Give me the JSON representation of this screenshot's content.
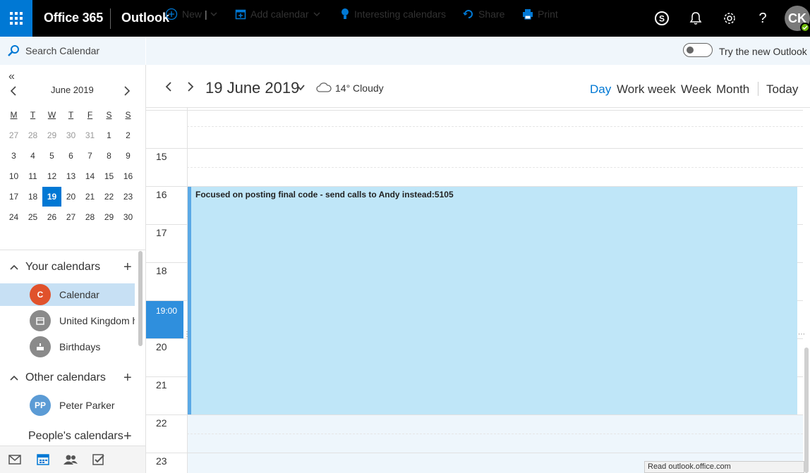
{
  "topbar": {
    "suite_name": "Office 365",
    "app_name": "Outlook",
    "avatar_initials": "CK",
    "accent_color": "#0078d4"
  },
  "search": {
    "label": "Search Calendar"
  },
  "commands": {
    "new_label": "New",
    "add_calendar_label": "Add calendar",
    "interesting_label": "Interesting calendars",
    "share_label": "Share",
    "print_label": "Print",
    "try_new_label": "Try the new Outlook"
  },
  "mini_calendar": {
    "collapse_glyph": "«",
    "month_title": "June 2019",
    "weekdays": [
      "M",
      "T",
      "W",
      "T",
      "F",
      "S",
      "S"
    ],
    "weeks": [
      [
        "27",
        "28",
        "29",
        "30",
        "31",
        "1",
        "2"
      ],
      [
        "3",
        "4",
        "5",
        "6",
        "7",
        "8",
        "9"
      ],
      [
        "10",
        "11",
        "12",
        "13",
        "14",
        "15",
        "16"
      ],
      [
        "17",
        "18",
        "19",
        "20",
        "21",
        "22",
        "23"
      ],
      [
        "24",
        "25",
        "26",
        "27",
        "28",
        "29",
        "30"
      ]
    ],
    "selected_day": "19"
  },
  "your_calendars": {
    "heading": "Your calendars",
    "items": [
      {
        "initial": "C",
        "name": "Calendar",
        "color": "#e0522c"
      },
      {
        "initial": "",
        "name": "United Kingdom holidays",
        "color": "#8a8a8a"
      },
      {
        "initial": "",
        "name": "Birthdays",
        "color": "#8a8a8a"
      }
    ]
  },
  "other_calendars": {
    "heading": "Other calendars",
    "items": [
      {
        "initial": "PP",
        "name": "Peter Parker",
        "color": "#5b9bd5"
      }
    ]
  },
  "peoples_calendars": {
    "heading": "People's calendars"
  },
  "header": {
    "date_title": "19 June 2019",
    "weather": "14° Cloudy",
    "views": {
      "day": "Day",
      "work_week": "Work week",
      "week": "Week",
      "month": "Month",
      "today": "Today"
    }
  },
  "grid": {
    "hours": [
      "15",
      "16",
      "17",
      "18",
      "20",
      "21",
      "22",
      "23"
    ],
    "current_time": "19:00"
  },
  "event": {
    "title": "Focused on posting final code - send calls to Andy instead:5105"
  },
  "status_tip": "Read outlook.office.com"
}
